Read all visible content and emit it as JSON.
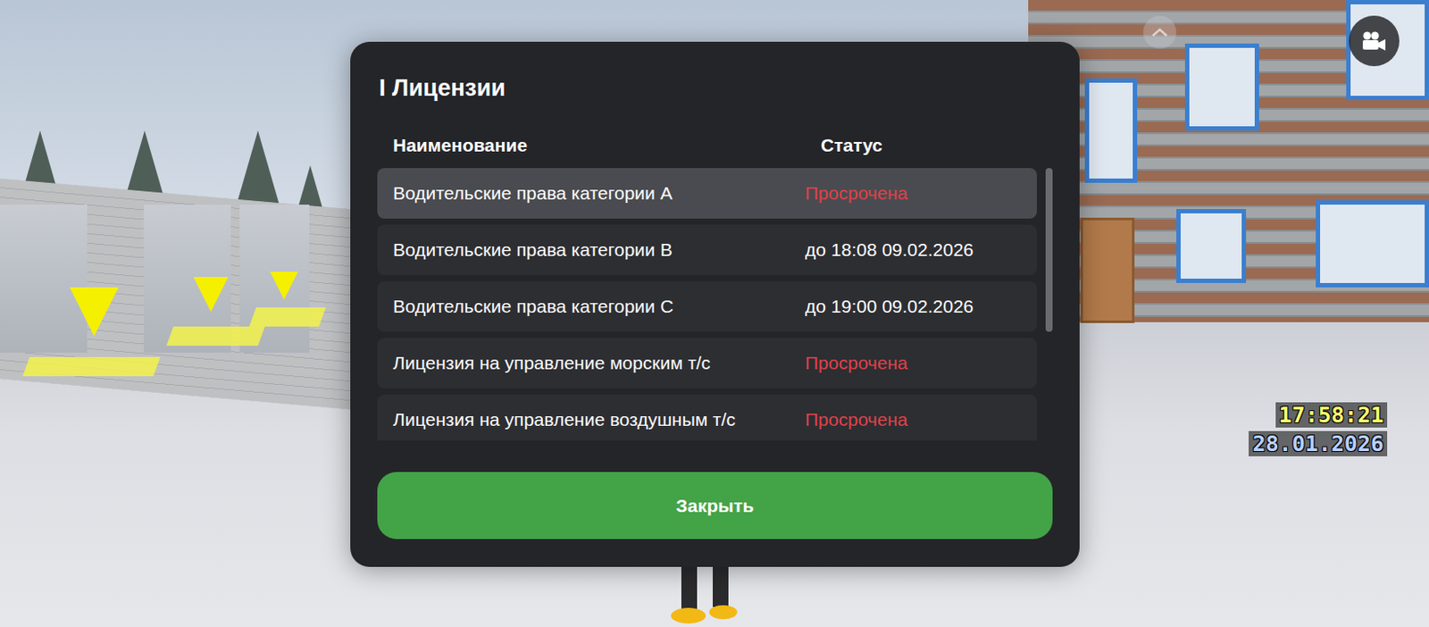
{
  "title": "I Лицензии",
  "table": {
    "columns": [
      "Наименование",
      "Статус"
    ],
    "rows": [
      {
        "name": "Водительские права категории A",
        "status": "Просрочена",
        "expired": true,
        "selected": true
      },
      {
        "name": "Водительские права категории B",
        "status": "до 18:08 09.02.2026",
        "expired": false,
        "selected": false
      },
      {
        "name": "Водительские права категории C",
        "status": "до 19:00 09.02.2026",
        "expired": false,
        "selected": false
      },
      {
        "name": "Лицензия на управление морским т/с",
        "status": "Просрочена",
        "expired": true,
        "selected": false
      },
      {
        "name": "Лицензия на управление воздушным т/с",
        "status": "Просрочена",
        "expired": true,
        "selected": false
      }
    ]
  },
  "scrollbar": {
    "level": 0.6
  },
  "buttons": [
    "Закрыть"
  ],
  "hud": {
    "time": "17:58:21",
    "date": "28.01.2026"
  }
}
